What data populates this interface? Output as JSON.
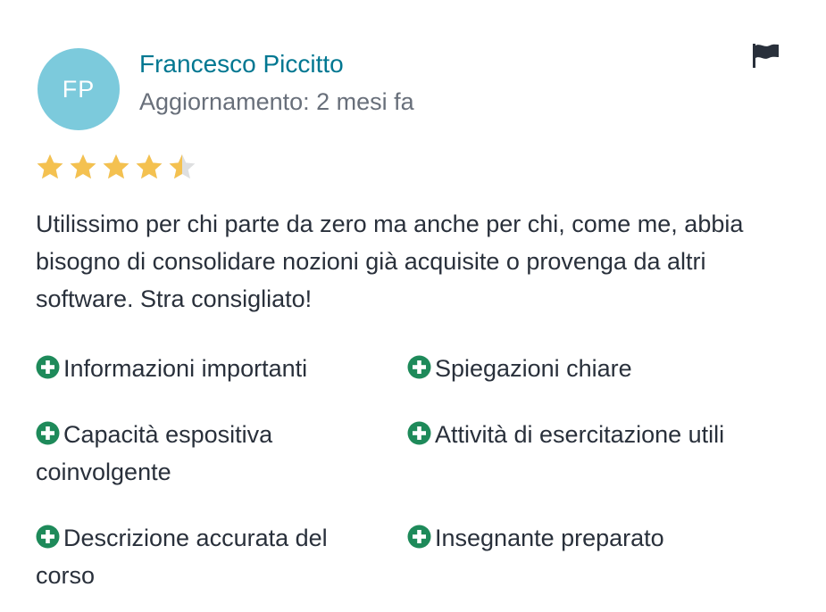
{
  "review": {
    "avatar_initials": "FP",
    "reviewer_name": "Francesco Piccitto",
    "updated_text": "Aggiornamento: 2 mesi fa",
    "rating": 4.5,
    "rating_max": 5,
    "body": "Utilissimo per chi parte da zero ma anche per chi, come me, abbia bisogno di consolidare nozioni già acquisite o provenga da altri software. Stra consigliato!",
    "attributes": [
      "Informazioni importanti",
      "Spiegazioni chiare",
      "Capacità espositiva coinvolgente",
      "Attività di esercitazione utili",
      "Descrizione accurata del corso",
      "Insegnante preparato"
    ]
  },
  "icons": {
    "flag": "flag-icon",
    "star": "star-icon",
    "attribute": "plus-circle-icon"
  },
  "colors": {
    "name": "#007791",
    "avatar_bg": "#7ccadc",
    "star_filled": "#f4c150",
    "star_empty": "#dedfe0",
    "plus_icon": "#1e8a5a",
    "text": "#29303b",
    "muted": "#686f7a",
    "flag": "#29303b"
  }
}
